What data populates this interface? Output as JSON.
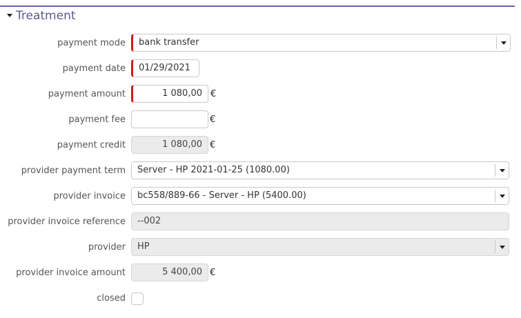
{
  "section": {
    "title": "Treatment"
  },
  "fields": {
    "payment_mode": {
      "label": "payment mode",
      "value": "bank transfer"
    },
    "payment_date": {
      "label": "payment date",
      "value": "01/29/2021"
    },
    "payment_amount": {
      "label": "payment amount",
      "value": "1 080,00",
      "currency": "€"
    },
    "payment_fee": {
      "label": "payment fee",
      "value": "",
      "currency": "€"
    },
    "payment_credit": {
      "label": "payment credit",
      "value": "1 080,00",
      "currency": "€"
    },
    "provider_payment_term": {
      "label": "provider payment term",
      "value": "Server - HP 2021-01-25 (1080.00)"
    },
    "provider_invoice": {
      "label": "provider invoice",
      "value": "bc558/889-66 - Server - HP (5400.00)"
    },
    "provider_invoice_reference": {
      "label": "provider invoice reference",
      "value": "--002"
    },
    "provider": {
      "label": "provider",
      "value": "HP"
    },
    "provider_invoice_amount": {
      "label": "provider invoice amount",
      "value": "5 400,00",
      "currency": "€"
    },
    "closed": {
      "label": "closed",
      "checked": false
    }
  },
  "icons": {
    "section_toggle": "caret-down-icon",
    "select_arrow": "chevron-down-icon"
  },
  "colors": {
    "header_rule": "#6b5fa3",
    "title": "#5b5b8f",
    "required_marker": "#d11a1a",
    "readonly_bg": "#ebebeb"
  }
}
